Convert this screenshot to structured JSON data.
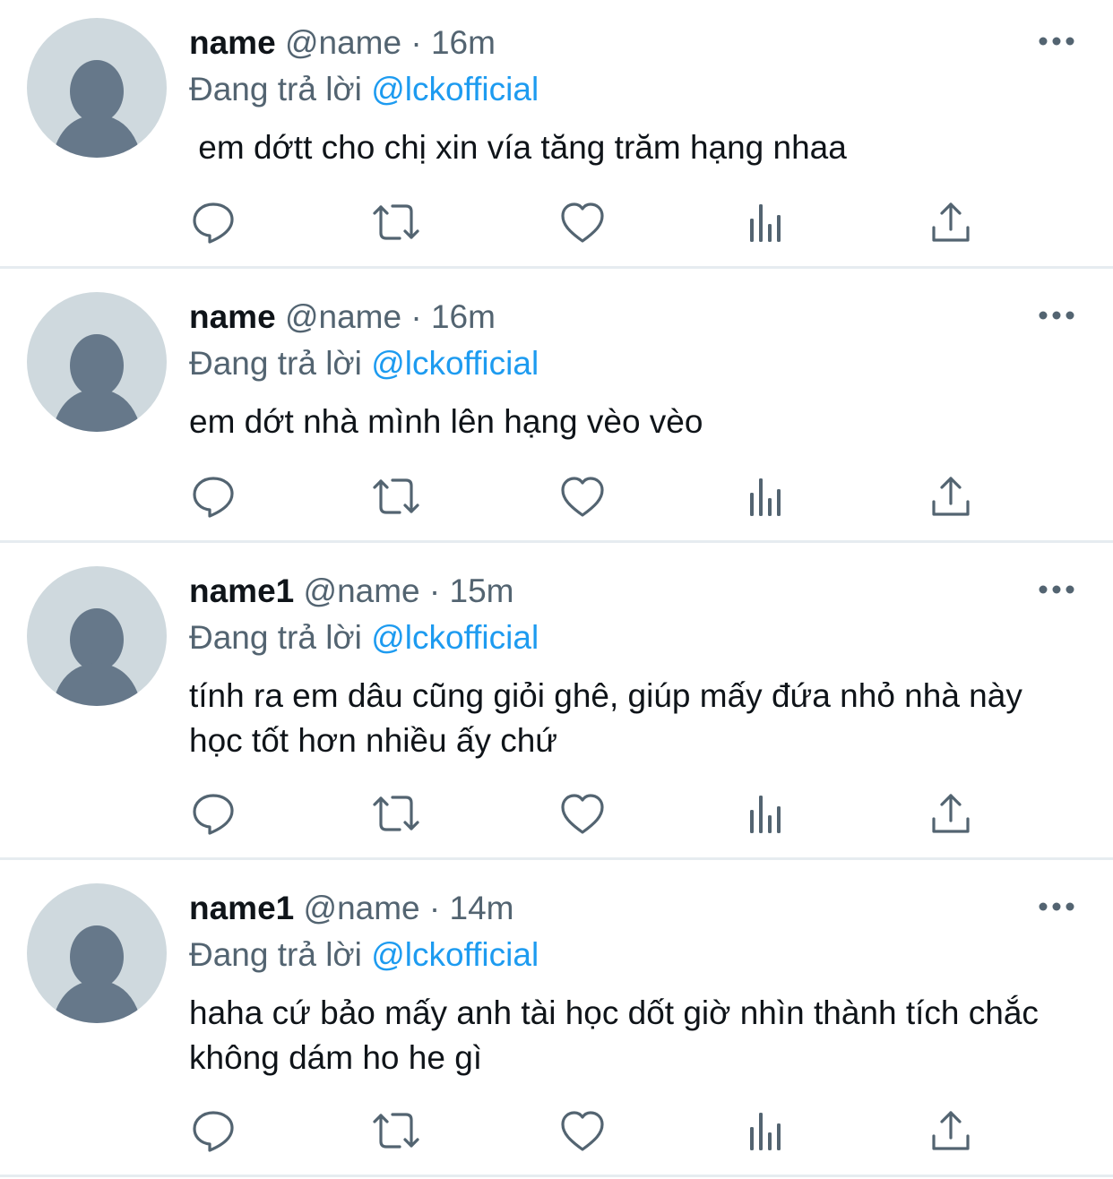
{
  "tweets": [
    {
      "display_name": "name",
      "handle": "@name",
      "separator": "·",
      "time": "16m",
      "reply_prefix": "Đang trả lời",
      "reply_to": "@lckofficial",
      "text": " em dớtt cho chị xin vía tăng trăm hạng nhaa"
    },
    {
      "display_name": "name",
      "handle": "@name",
      "separator": "·",
      "time": "16m",
      "reply_prefix": "Đang trả lời",
      "reply_to": "@lckofficial",
      "text": "em dớt nhà mình lên hạng vèo vèo"
    },
    {
      "display_name": "name1",
      "handle": "@name",
      "separator": "·",
      "time": "15m",
      "reply_prefix": "Đang trả lời",
      "reply_to": "@lckofficial",
      "text": "tính ra em dâu cũng giỏi ghê, giúp mấy đứa nhỏ nhà này học tốt hơn nhiều ấy chứ"
    },
    {
      "display_name": "name1",
      "handle": "@name",
      "separator": "·",
      "time": "14m",
      "reply_prefix": "Đang trả lời",
      "reply_to": "@lckofficial",
      "text": "haha cứ bảo mấy anh tài học dốt giờ nhìn thành tích chắc không dám ho he gì"
    }
  ],
  "icons": {
    "more": "more-horizontal-icon",
    "reply": "reply-bubble-icon",
    "retweet": "retweet-icon",
    "like": "heart-icon",
    "views": "analytics-bars-icon",
    "share": "share-upload-icon",
    "avatar": "default-avatar-icon"
  },
  "colors": {
    "background": "#ffffff",
    "text": "#0f1419",
    "secondary_text": "#536471",
    "mention": "#1d9bf0",
    "avatar_bg": "#cfd9de",
    "avatar_fg": "#66788a",
    "divider": "#e6ecf0"
  }
}
